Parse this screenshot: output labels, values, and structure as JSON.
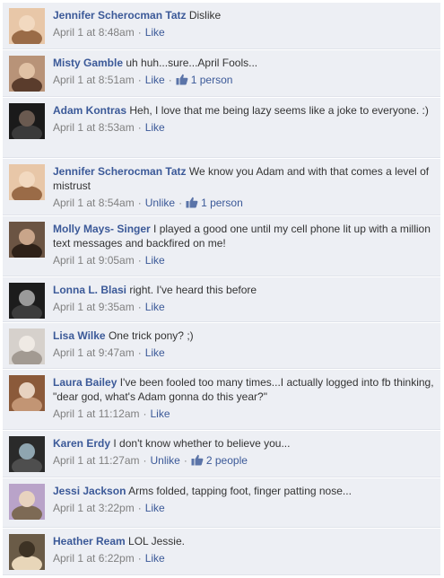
{
  "comments": [
    {
      "author": "Jennifer Scherocman Tatz",
      "text": "Dislike",
      "time": "April 1 at 8:48am",
      "like_label": "Like",
      "likes": ""
    },
    {
      "author": "Misty Gamble",
      "text": "uh huh...sure...April Fools...",
      "time": "April 1 at 8:51am",
      "like_label": "Like",
      "likes": "1 person"
    },
    {
      "author": "Adam Kontras",
      "text": "Heh, I love that me being lazy seems like a joke to everyone. :)",
      "time": "April 1 at 8:53am",
      "like_label": "Like",
      "likes": ""
    },
    {
      "author": "Jennifer Scherocman Tatz",
      "text": "We know you Adam and with that comes a level of mistrust",
      "time": "April 1 at 8:54am",
      "like_label": "Unlike",
      "likes": "1 person"
    },
    {
      "author": "Molly Mays- Singer",
      "text": "I played a good one until my cell phone lit up with a million text messages and backfired on me!",
      "time": "April 1 at 9:05am",
      "like_label": "Like",
      "likes": ""
    },
    {
      "author": "Lonna L. Blasi",
      "text": "right. I've heard this before",
      "time": "April 1 at 9:35am",
      "like_label": "Like",
      "likes": ""
    },
    {
      "author": "Lisa Wilke",
      "text": "One trick pony? ;)",
      "time": "April 1 at 9:47am",
      "like_label": "Like",
      "likes": ""
    },
    {
      "author": "Laura Bailey",
      "text": "I've been fooled too many times...I actually logged into fb thinking, \"dear god, what's Adam gonna do this year?\"",
      "time": "April 1 at 11:12am",
      "like_label": "Like",
      "likes": ""
    },
    {
      "author": "Karen Erdy",
      "text": "I don't know whether to believe you...",
      "time": "April 1 at 11:27am",
      "like_label": "Unlike",
      "likes": "2 people"
    },
    {
      "author": "Jessi Jackson",
      "text": "Arms folded, tapping foot, finger patting nose...",
      "time": "April 1 at 3:22pm",
      "like_label": "Like",
      "likes": ""
    },
    {
      "author": "Heather Ream",
      "text": "LOL Jessie.",
      "time": "April 1 at 6:22pm",
      "like_label": "Like",
      "likes": ""
    }
  ],
  "icons": {
    "likes": "thumbs-up-icon"
  },
  "colors": {
    "background": "#edeff4",
    "link": "#3b5998",
    "meta": "#808080",
    "text": "#333333"
  }
}
